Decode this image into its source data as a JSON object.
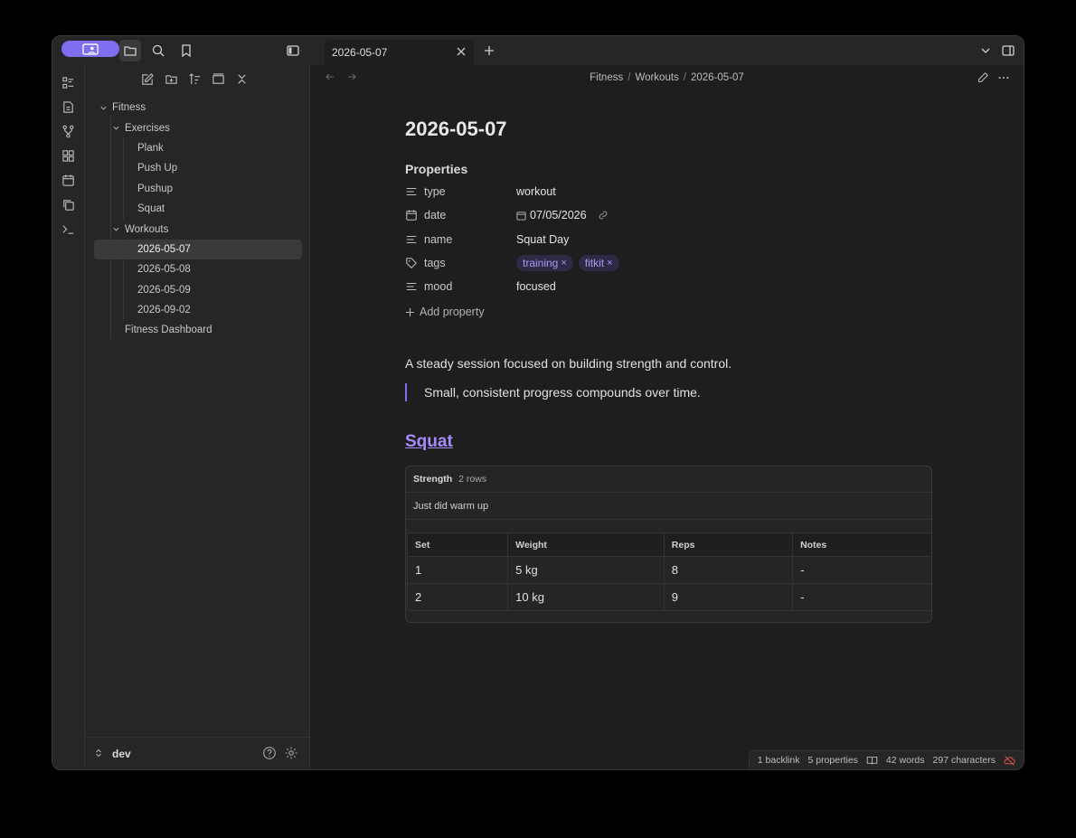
{
  "tab": {
    "title": "2026-05-07"
  },
  "breadcrumb": {
    "items": [
      "Fitness",
      "Workouts",
      "2026-05-07"
    ]
  },
  "sidebar": {
    "tree": [
      {
        "label": "Fitness",
        "level": 0,
        "folder": true
      },
      {
        "label": "Exercises",
        "level": 1,
        "folder": true
      },
      {
        "label": "Plank",
        "level": 2,
        "folder": false
      },
      {
        "label": "Push Up",
        "level": 2,
        "folder": false
      },
      {
        "label": "Pushup",
        "level": 2,
        "folder": false
      },
      {
        "label": "Squat",
        "level": 2,
        "folder": false
      },
      {
        "label": "Workouts",
        "level": 1,
        "folder": true
      },
      {
        "label": "2026-05-07",
        "level": 2,
        "folder": false,
        "active": true
      },
      {
        "label": "2026-05-08",
        "level": 2,
        "folder": false
      },
      {
        "label": "2026-05-09",
        "level": 2,
        "folder": false
      },
      {
        "label": "2026-09-02",
        "level": 2,
        "folder": false
      },
      {
        "label": "Fitness Dashboard",
        "level": 1,
        "folder": false
      }
    ],
    "vault_name": "dev"
  },
  "note": {
    "title": "2026-05-07",
    "properties_heading": "Properties",
    "properties": {
      "type": {
        "key": "type",
        "value": "workout"
      },
      "date": {
        "key": "date",
        "value": "07/05/2026"
      },
      "name": {
        "key": "name",
        "value": "Squat Day"
      },
      "tags": {
        "key": "tags",
        "values": [
          "training",
          "fitkit"
        ],
        "remove": "×"
      },
      "mood": {
        "key": "mood",
        "value": "focused"
      }
    },
    "add_property": "Add property",
    "paragraph": "A steady session focused on building strength and control.",
    "quote": "Small, consistent progress compounds over time.",
    "heading_link": "Squat"
  },
  "database": {
    "name": "Strength",
    "count": "2 rows",
    "description": "Just did warm up",
    "columns": [
      "Set",
      "Weight",
      "Reps",
      "Notes"
    ],
    "rows": [
      [
        "1",
        "5 kg",
        "8",
        "-"
      ],
      [
        "2",
        "10 kg",
        "9",
        "-"
      ]
    ]
  },
  "status": {
    "backlinks": "1 backlink",
    "properties": "5 properties",
    "words": "42 words",
    "characters": "297 characters"
  },
  "colors": {
    "accent": "#7f6df2",
    "link": "#a78bfa",
    "tag_bg": "#2d2a45",
    "sync_error": "#e05252"
  }
}
